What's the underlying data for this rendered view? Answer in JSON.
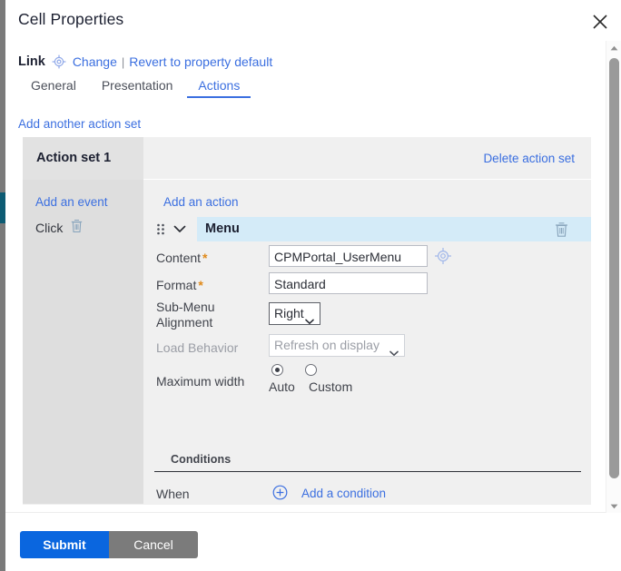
{
  "window": {
    "title": "Cell Properties",
    "close_icon": "close-icon"
  },
  "link_row": {
    "label": "Link",
    "target_icon": "target-crosshair-icon",
    "change_label": "Change",
    "separator": "|",
    "revert_label": "Revert to property default"
  },
  "tabs": [
    {
      "label": "General",
      "active": false
    },
    {
      "label": "Presentation",
      "active": false
    },
    {
      "label": "Actions",
      "active": true
    }
  ],
  "toolbar": {
    "add_another_action_set": "Add another action set"
  },
  "action_set": {
    "title": "Action set 1",
    "delete_label": "Delete action set",
    "events": {
      "add_label": "Add an event",
      "items": [
        {
          "label": "Click",
          "delete_icon": "trash-icon"
        }
      ]
    },
    "actions": {
      "add_label": "Add an action",
      "item": {
        "drag_icon": "drag-handle-icon",
        "collapse_icon": "chevron-down-icon",
        "name": "Menu",
        "delete_icon": "trash-icon"
      },
      "properties": [
        {
          "label": "Content",
          "required": true,
          "value": "CPMPortal_UserMenu",
          "picker_icon": "target-crosshair-icon"
        },
        {
          "label": "Format",
          "required": true,
          "value": "Standard"
        },
        {
          "label": "Sub-Menu Alignment",
          "label_line1": "Sub-Menu",
          "label_line2": "Alignment",
          "value": "Right",
          "disabled": false
        },
        {
          "label": "Load Behavior",
          "value": "Refresh on display",
          "disabled": true
        },
        {
          "label": "Maximum width",
          "disabled": true,
          "options": [
            "Auto",
            "Custom"
          ],
          "selected": "Auto"
        }
      ]
    },
    "conditions": {
      "header": "Conditions",
      "when_label": "When",
      "add_icon": "plus-circle-icon",
      "add_label": "Add a condition"
    }
  },
  "footer": {
    "submit_label": "Submit",
    "cancel_label": "Cancel"
  },
  "scrollbar": {
    "up_icon": "caret-up-icon",
    "down_icon": "caret-down-icon"
  },
  "colors": {
    "accent_blue": "#3b6fe0",
    "submit_blue": "#0a66df",
    "cancel_gray": "#7b7b7b",
    "highlight_blue": "#d4ebf8",
    "required_star": "#e08a1a"
  }
}
